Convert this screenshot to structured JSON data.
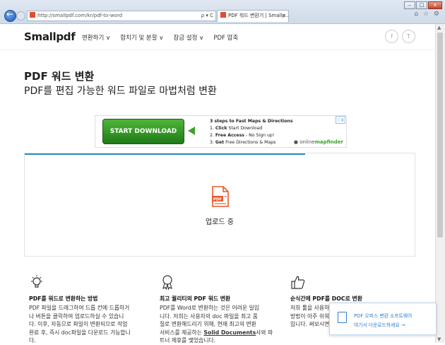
{
  "browser": {
    "url": "http://smallpdf.com/kr/pdf-to-word",
    "tab_title": "PDF 워드 변환기 | Smallp...",
    "tab_close": "×",
    "address_tools": "ρ ▾ C",
    "icons": "⌂ ☆ ⚙"
  },
  "site": {
    "logo": "Smallpdf",
    "nav": [
      "변환하기 ∨",
      "합치기 및 분할 ∨",
      "잠금 설정 ∨",
      "PDF 압축"
    ],
    "social": [
      "f",
      "T"
    ]
  },
  "page": {
    "title": "PDF 워드 변환",
    "subtitle": "PDF를 편집 가능한 워드 파일로 마법처럼 변환"
  },
  "ad": {
    "button": "START DOWNLOAD",
    "headline": "3 steps to Fast Maps & Directions",
    "steps": [
      {
        "num": "1.",
        "bold": "Click",
        "rest": " Start Download"
      },
      {
        "num": "2.",
        "bold": "Free Access",
        "rest": " - No Sign up!"
      },
      {
        "num": "3.",
        "bold": "Get",
        "rest": " Free Directions & Maps"
      }
    ],
    "brand_a": "online",
    "brand_b": "mapfinder",
    "marker": "ⓘX"
  },
  "upload": {
    "icon_text": "PDF",
    "status": "업로드 중",
    "progress": 0.72
  },
  "features": [
    {
      "title": "PDF를 워드로 변환하는 방법",
      "lines": [
        "PDF 파일을 드래그하여 드롭 칸에 드롭하거",
        "나 버튼을 클릭하여 업로드하실 수 있습니",
        "다. 이후, 자동으로 파일이 변환되므로 작업",
        "완료 후, 즉시 doc파일을 다운로드 가능합니",
        "다."
      ]
    },
    {
      "title": "최고 퀄리티의 PDF 워드 변환",
      "lines": [
        "PDF를 Word로 변환하는 것은 어려운 일입",
        "니다. 저희는 사용자의 doc 파일을 최고 품",
        "질로 변환해드리기 위해, 현재 최고의 변환"
      ],
      "line4_pre": "서비스를 제공하는 ",
      "line4_link": "Solid Documents",
      "line4_post": "사와 파",
      "line5": "트너 제휴를 맺었습니다."
    },
    {
      "title": "순식간에 PDF를 DOC로 변환",
      "lines": [
        "저희 툴을 사용하여 PDF를 변환하는 것은",
        "방법이 아주 쉬워서 누구나 사용할 수 있",
        "입니다. 써보시면 아시게 될 거예요."
      ]
    }
  ],
  "promo": {
    "line1": "PDF 오피스 변환 소프트웨어",
    "line2": "여기서 다운로드하세요 →"
  }
}
